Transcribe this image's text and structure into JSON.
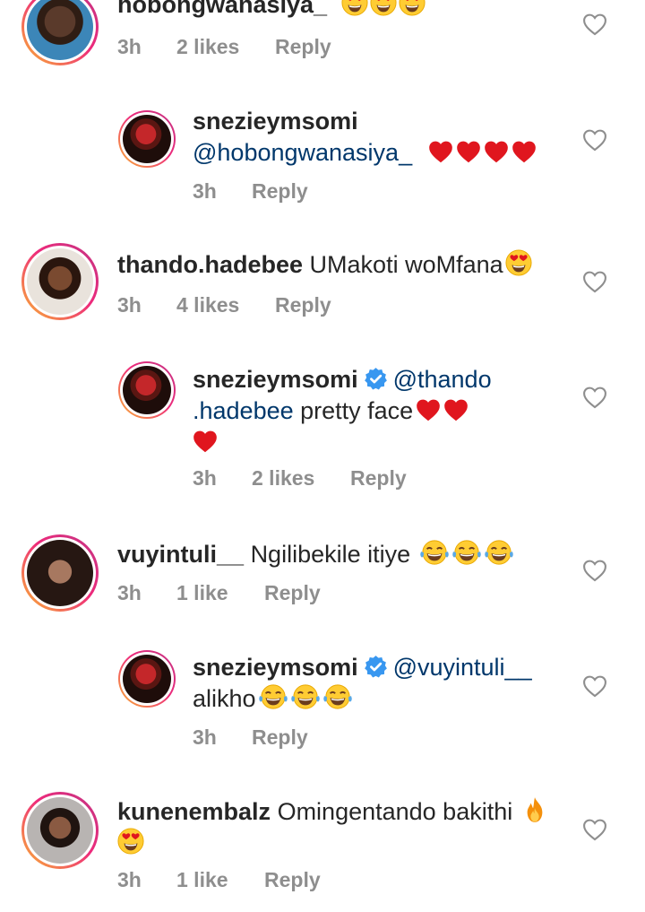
{
  "comments": [
    {
      "username": "hobongwanasiya_",
      "text": "",
      "emojis": [
        "heart-eyes",
        "heart-eyes",
        "heart-eyes"
      ],
      "time": "3h",
      "likes": "2 likes",
      "reply_label": "Reply"
    },
    {
      "username": "snezieymsomi",
      "mention": "@hobongwanasiya_",
      "text": "",
      "emojis": [
        "red-heart",
        "red-heart",
        "red-heart",
        "red-heart"
      ],
      "time": "3h",
      "likes": "",
      "reply_label": "Reply"
    },
    {
      "username": "thando.hadebee",
      "text": "UMakoti woMfana",
      "emojis": [
        "heart-eyes"
      ],
      "time": "3h",
      "likes": "4 likes",
      "reply_label": "Reply"
    },
    {
      "username": "snezieymsomi",
      "verified": true,
      "mention_line1": "@thando",
      "mention_line2": ".hadebee",
      "text": "pretty face",
      "emojis": [
        "red-heart",
        "red-heart",
        "red-heart"
      ],
      "time": "3h",
      "likes": "2 likes",
      "reply_label": "Reply"
    },
    {
      "username": "vuyintuli__",
      "text": "Ngilibekile itiye",
      "emojis": [
        "tears-of-joy",
        "tears-of-joy",
        "tears-of-joy"
      ],
      "time": "3h",
      "likes": "1 like",
      "reply_label": "Reply"
    },
    {
      "username": "snezieymsomi",
      "verified": true,
      "mention": "@vuyintuli__",
      "text": "alikho",
      "emojis": [
        "tears-of-joy",
        "tears-of-joy",
        "tears-of-joy"
      ],
      "time": "3h",
      "likes": "",
      "reply_label": "Reply"
    },
    {
      "username": "kunenembalz",
      "text": "Omingentando bakithi",
      "emojis": [
        "fire",
        "heart-eyes"
      ],
      "time": "3h",
      "likes": "1 like",
      "reply_label": "Reply"
    }
  ],
  "colors": {
    "text": "#262626",
    "meta": "#8e8e8e",
    "mention": "#00376b",
    "verified": "#3897f0",
    "heart": "#e0161e",
    "ring_start": "#f9b533",
    "ring_end": "#c13584"
  },
  "icons": {
    "like": "heart-outline-icon",
    "verified": "verified-badge-icon"
  }
}
